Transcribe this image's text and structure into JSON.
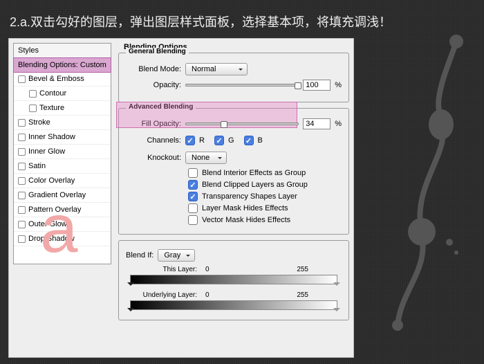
{
  "instruction": "2.a.双击勾好的图层，弹出图层样式面板，选择基本项，将填充调浅！",
  "styles_header": "Styles",
  "styles": [
    {
      "label": "Blending Options: Custom",
      "checked": null,
      "selected": true
    },
    {
      "label": "Bevel & Emboss",
      "checked": false
    },
    {
      "label": "Contour",
      "checked": false,
      "indent": true
    },
    {
      "label": "Texture",
      "checked": false,
      "indent": true
    },
    {
      "label": "Stroke",
      "checked": false
    },
    {
      "label": "Inner Shadow",
      "checked": false
    },
    {
      "label": "Inner Glow",
      "checked": false
    },
    {
      "label": "Satin",
      "checked": false
    },
    {
      "label": "Color Overlay",
      "checked": false
    },
    {
      "label": "Gradient Overlay",
      "checked": false
    },
    {
      "label": "Pattern Overlay",
      "checked": false
    },
    {
      "label": "Outer Glow",
      "checked": false
    },
    {
      "label": "Drop Shadow",
      "checked": false
    }
  ],
  "options_title": "Blending Options",
  "general": {
    "legend": "General Blending",
    "blend_mode_label": "Blend Mode:",
    "blend_mode_value": "Normal",
    "opacity_label": "Opacity:",
    "opacity_value": "100",
    "opacity_slider_pct": 100
  },
  "advanced": {
    "legend": "Advanced Blending",
    "fill_opacity_label": "Fill Opacity:",
    "fill_opacity_value": "34",
    "fill_opacity_slider_pct": 34,
    "channels_label": "Channels:",
    "channel_r": "R",
    "channel_g": "G",
    "channel_b": "B",
    "knockout_label": "Knockout:",
    "knockout_value": "None",
    "checks": [
      {
        "label": "Blend Interior Effects as Group",
        "checked": false
      },
      {
        "label": "Blend Clipped Layers as Group",
        "checked": true
      },
      {
        "label": "Transparency Shapes Layer",
        "checked": true
      },
      {
        "label": "Layer Mask Hides Effects",
        "checked": false
      },
      {
        "label": "Vector Mask Hides Effects",
        "checked": false
      }
    ]
  },
  "blendif": {
    "label": "Blend If:",
    "value": "Gray",
    "this_layer_label": "This Layer:",
    "this_layer_low": "0",
    "this_layer_high": "255",
    "underlying_label": "Underlying Layer:",
    "underlying_low": "0",
    "underlying_high": "255"
  },
  "watermark": "a",
  "percent": "%"
}
